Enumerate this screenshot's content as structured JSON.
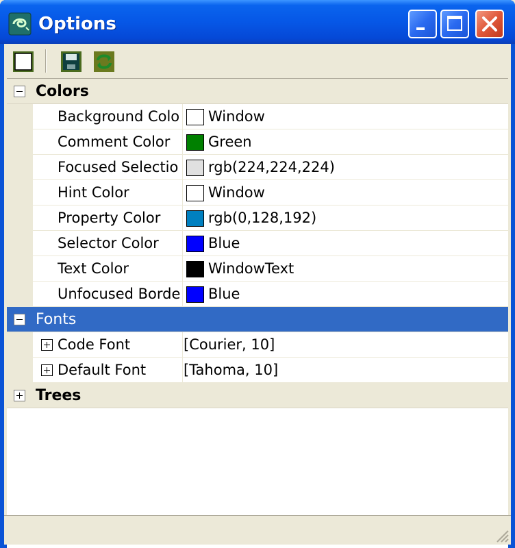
{
  "window": {
    "title": "Options",
    "icon": "app-swirl-icon",
    "controls": [
      "minimize-icon",
      "maximize-icon",
      "close-icon"
    ]
  },
  "toolbar": {
    "items": [
      {
        "name": "new-page-icon"
      },
      {
        "name": "save-disk-icon"
      },
      {
        "name": "refresh-icon"
      }
    ]
  },
  "grid": {
    "categories": [
      {
        "label": "Colors",
        "expanded": true,
        "selected": false,
        "properties": [
          {
            "name": "Background Colo",
            "value": "Window",
            "swatch": "#ffffff"
          },
          {
            "name": "Comment Color",
            "value": "Green",
            "swatch": "#008000"
          },
          {
            "name": "Focused Selectio",
            "value": "rgb(224,224,224)",
            "swatch": "#e0e0e0"
          },
          {
            "name": "Hint Color",
            "value": "Window",
            "swatch": "#ffffff"
          },
          {
            "name": "Property Color",
            "value": "rgb(0,128,192)",
            "swatch": "#0080c0"
          },
          {
            "name": "Selector Color",
            "value": "Blue",
            "swatch": "#0000ff"
          },
          {
            "name": "Text Color",
            "value": "WindowText",
            "swatch": "#000000"
          },
          {
            "name": "Unfocused Borde",
            "value": "Blue",
            "swatch": "#0000ff"
          }
        ]
      },
      {
        "label": "Fonts",
        "expanded": true,
        "selected": true,
        "properties": [
          {
            "name": "Code Font",
            "value": "[Courier, 10]"
          },
          {
            "name": "Default Font",
            "value": "[Tahoma, 10]"
          }
        ]
      },
      {
        "label": "Trees",
        "expanded": false,
        "selected": false,
        "properties": []
      }
    ]
  },
  "colors": {
    "title_bar": "#0657e6",
    "selection": "#316ac5",
    "panel": "#ece9d8"
  }
}
